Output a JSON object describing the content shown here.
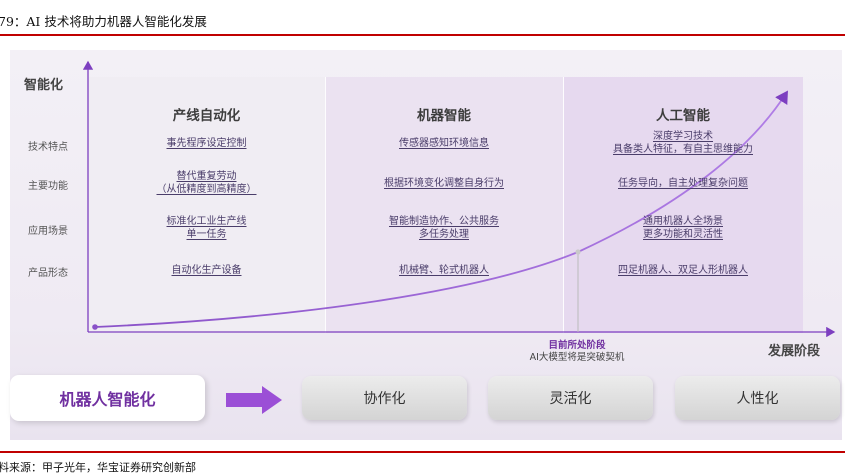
{
  "figure": {
    "title": "79：AI 技术将助力机器人智能化发展",
    "source": "料来源：甲子光年，华宝证券研究创新部"
  },
  "axes": {
    "y_label": "智能化",
    "x_label": "发展阶段"
  },
  "columns": [
    {
      "title": "产线自动化"
    },
    {
      "title": "机器智能"
    },
    {
      "title": "人工智能"
    }
  ],
  "rows": [
    {
      "label": "技术特点",
      "cells": [
        [
          "事先程序设定控制"
        ],
        [
          "传感器感知环境信息"
        ],
        [
          "深度学习技术",
          "具备类人特征，有自主思维能力"
        ]
      ]
    },
    {
      "label": "主要功能",
      "cells": [
        [
          "替代重复劳动",
          "（从低精度到高精度）"
        ],
        [
          "根据环境变化调整自身行为"
        ],
        [
          "任务导向，自主处理复杂问题"
        ]
      ]
    },
    {
      "label": "应用场景",
      "cells": [
        [
          "标准化工业生产线",
          "单一任务"
        ],
        [
          "智能制造协作、公共服务",
          "多任务处理"
        ],
        [
          "通用机器人全场景",
          "更多功能和灵活性"
        ]
      ]
    },
    {
      "label": "产品形态",
      "cells": [
        [
          "自动化生产设备"
        ],
        [
          "机械臂、轮式机器人"
        ],
        [
          "四足机器人、双足人形机器人"
        ]
      ]
    }
  ],
  "stage_marker": {
    "title": "目前所处阶段",
    "subtitle": "AI大模型将是突破契机"
  },
  "bottom": {
    "main_label": "机器人智能化",
    "steps": [
      {
        "label": "协作化"
      },
      {
        "label": "灵活化"
      },
      {
        "label": "人性化"
      }
    ]
  },
  "colors": {
    "accent": "#7030a0",
    "rule": "#c00000",
    "arrow": "#9b4fd6"
  },
  "icons": {
    "arrow": "right-arrow-icon"
  }
}
